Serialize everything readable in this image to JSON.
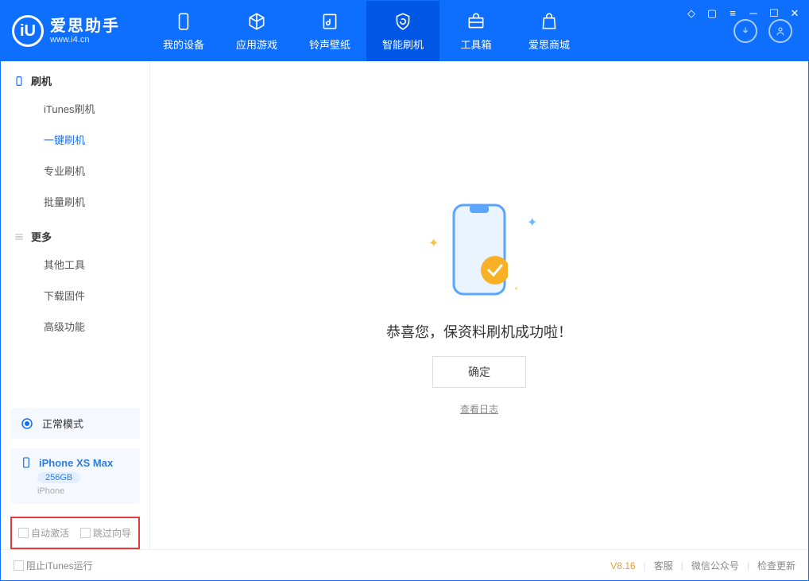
{
  "app": {
    "name_cn": "爱思助手",
    "name_en": "www.i4.cn"
  },
  "tabs": {
    "device": "我的设备",
    "apps": "应用游戏",
    "ring": "铃声壁纸",
    "flash": "智能刷机",
    "tools": "工具箱",
    "store": "爱思商城"
  },
  "sidebar": {
    "sec1": "刷机",
    "items1": {
      "itunes": "iTunes刷机",
      "oneclick": "一键刷机",
      "pro": "专业刷机",
      "batch": "批量刷机"
    },
    "sec2": "更多",
    "items2": {
      "other": "其他工具",
      "firmware": "下载固件",
      "adv": "高级功能"
    }
  },
  "mode": "正常模式",
  "device": {
    "name": "iPhone XS Max",
    "capacity": "256GB",
    "type": "iPhone"
  },
  "checks": {
    "auto_activate": "自动激活",
    "skip_guide": "跳过向导"
  },
  "main": {
    "msg": "恭喜您，保资料刷机成功啦！",
    "ok": "确定",
    "log": "查看日志"
  },
  "footer": {
    "block_itunes": "阻止iTunes运行",
    "version": "V8.16",
    "cs": "客服",
    "wx": "微信公众号",
    "update": "检查更新"
  }
}
